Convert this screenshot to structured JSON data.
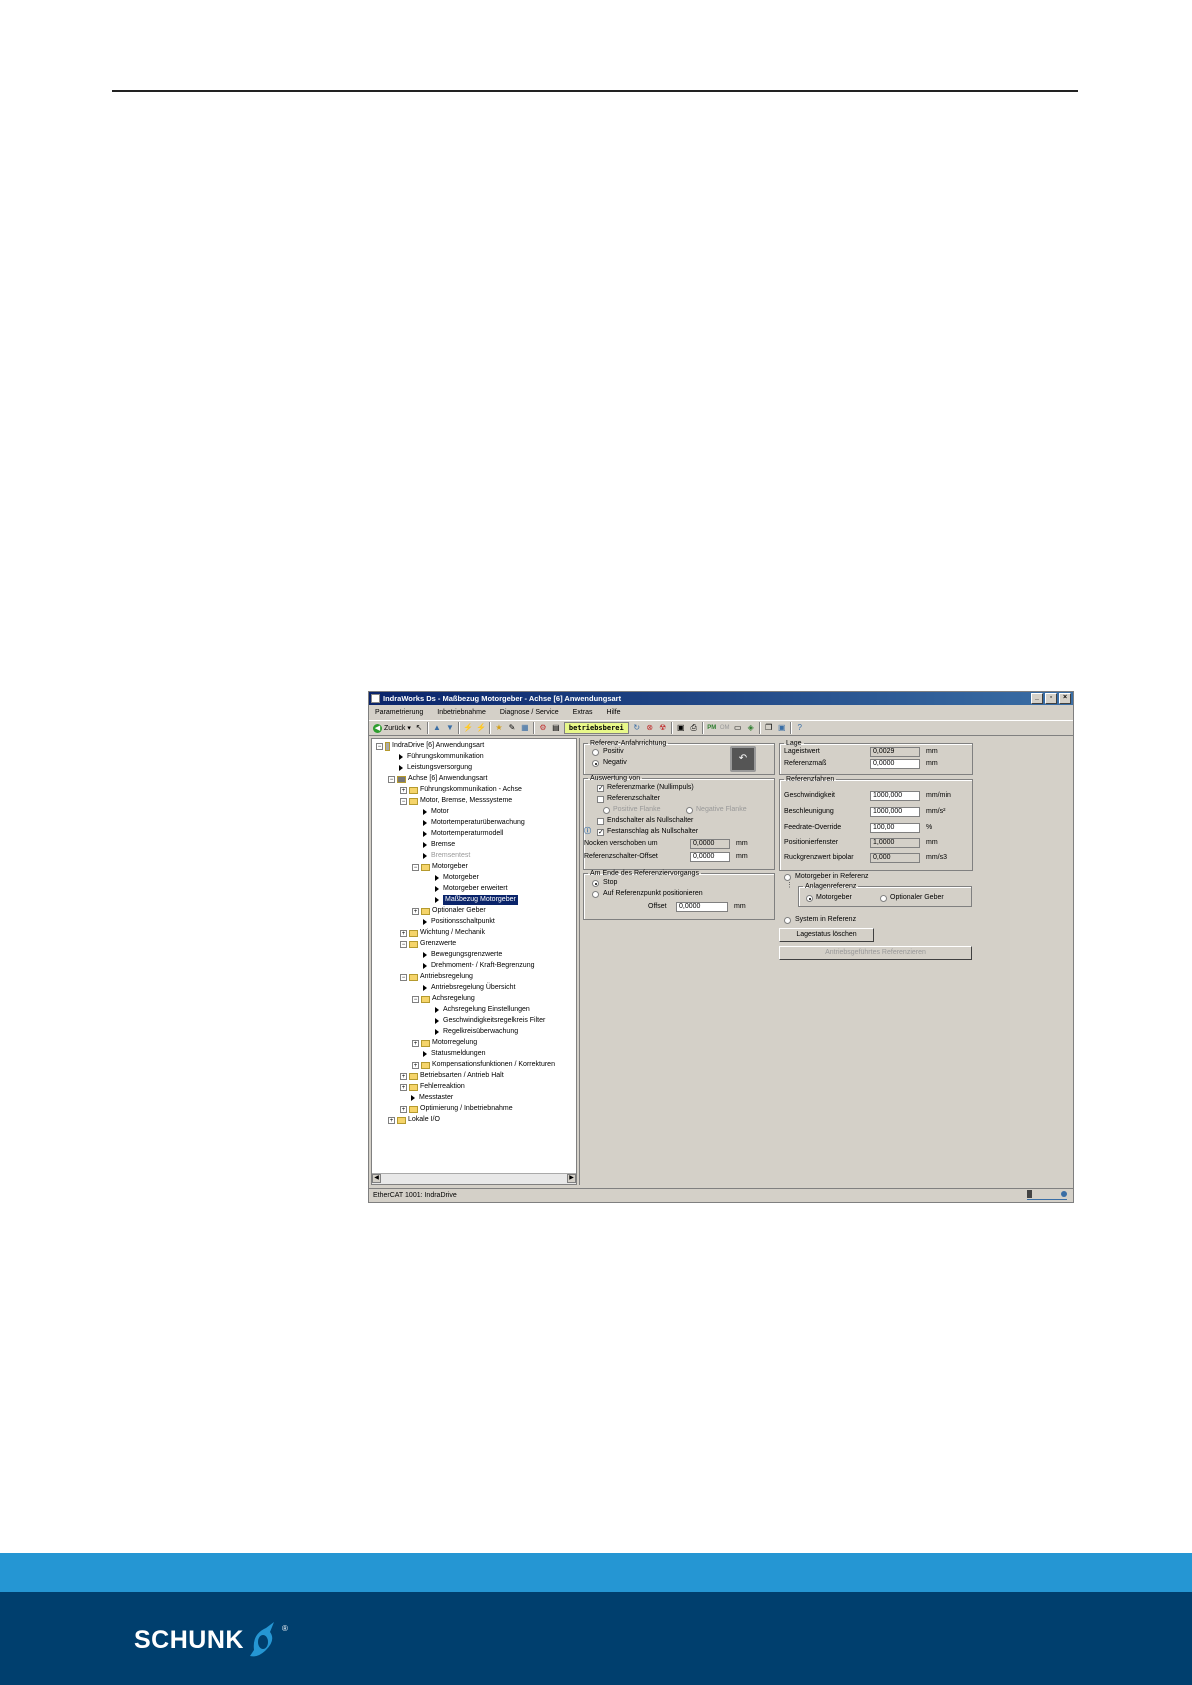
{
  "window": {
    "title": "IndraWorks Ds - Maßbezug Motorgeber - Achse [6] Anwendungsart",
    "controls": [
      "_",
      "▫",
      "×"
    ]
  },
  "menu": [
    "Parametrierung",
    "Inbetriebnahme",
    "Diagnose / Service",
    "Extras",
    "Hilfe"
  ],
  "toolbar": {
    "back_label": "Zurück",
    "status_text": "betriebsberei",
    "pm_label": "PM",
    "om_label": "OM"
  },
  "tree": [
    {
      "text": "IndraDrive [6] Anwendungsart",
      "level": 0,
      "kind": "device",
      "pm": "−"
    },
    {
      "text": "Führungskommunikation",
      "level": 1,
      "kind": "arrow"
    },
    {
      "text": "Leistungsversorgung",
      "level": 1,
      "kind": "arrow"
    },
    {
      "text": "Achse [6] Anwendungsart",
      "level": 1,
      "kind": "axis",
      "pm": "−"
    },
    {
      "text": "Führungskommunikation - Achse",
      "level": 2,
      "kind": "folder",
      "pm": "+"
    },
    {
      "text": "Motor, Bremse, Messsysteme",
      "level": 2,
      "kind": "folder",
      "pm": "−"
    },
    {
      "text": "Motor",
      "level": 3,
      "kind": "arrow"
    },
    {
      "text": "Motortemperaturüberwachung",
      "level": 3,
      "kind": "arrow"
    },
    {
      "text": "Motortemperaturmodell",
      "level": 3,
      "kind": "arrow"
    },
    {
      "text": "Bremse",
      "level": 3,
      "kind": "arrow"
    },
    {
      "text": "Bremsentest",
      "level": 3,
      "kind": "arrow",
      "gray": true
    },
    {
      "text": "Motorgeber",
      "level": 3,
      "kind": "folder",
      "pm": "−"
    },
    {
      "text": "Motorgeber",
      "level": 4,
      "kind": "arrow"
    },
    {
      "text": "Motorgeber erweitert",
      "level": 4,
      "kind": "arrow"
    },
    {
      "text": "Maßbezug Motorgeber",
      "level": 4,
      "kind": "arrow",
      "selected": true
    },
    {
      "text": "Optionaler Geber",
      "level": 3,
      "kind": "folder",
      "pm": "+"
    },
    {
      "text": "Positionsschaltpunkt",
      "level": 3,
      "kind": "arrow"
    },
    {
      "text": "Wichtung / Mechanik",
      "level": 2,
      "kind": "folder",
      "pm": "+"
    },
    {
      "text": "Grenzwerte",
      "level": 2,
      "kind": "folder",
      "pm": "−"
    },
    {
      "text": "Bewegungsgrenzwerte",
      "level": 3,
      "kind": "arrow"
    },
    {
      "text": "Drehmoment- / Kraft-Begrenzung",
      "level": 3,
      "kind": "arrow"
    },
    {
      "text": "Antriebsregelung",
      "level": 2,
      "kind": "folder",
      "pm": "−"
    },
    {
      "text": "Antriebsregelung Übersicht",
      "level": 3,
      "kind": "arrow"
    },
    {
      "text": "Achsregelung",
      "level": 3,
      "kind": "folder",
      "pm": "−"
    },
    {
      "text": "Achsregelung Einstellungen",
      "level": 4,
      "kind": "arrow"
    },
    {
      "text": "Geschwindigkeitsregelkreis Filter",
      "level": 4,
      "kind": "arrow"
    },
    {
      "text": "Regelkreisüberwachung",
      "level": 4,
      "kind": "arrow"
    },
    {
      "text": "Motorregelung",
      "level": 3,
      "kind": "folder",
      "pm": "+"
    },
    {
      "text": "Statusmeldungen",
      "level": 3,
      "kind": "arrow"
    },
    {
      "text": "Kompensationsfunktionen / Korrekturen",
      "level": 3,
      "kind": "folder",
      "pm": "+"
    },
    {
      "text": "Betriebsarten / Antrieb Halt",
      "level": 2,
      "kind": "folder",
      "pm": "+"
    },
    {
      "text": "Fehlerreaktion",
      "level": 2,
      "kind": "folder",
      "pm": "+"
    },
    {
      "text": "Messtaster",
      "level": 2,
      "kind": "arrow"
    },
    {
      "text": "Optimierung / Inbetriebnahme",
      "level": 2,
      "kind": "folder",
      "pm": "+"
    },
    {
      "text": "Lokale I/O",
      "level": 1,
      "kind": "folder",
      "pm": "+"
    }
  ],
  "ref_direction": {
    "legend": "Referenz-Anfahrrichtung",
    "positive": "Positiv",
    "negative": "Negativ",
    "icon": "reference-direction-icon"
  },
  "evaluation": {
    "legend": "Auswertung von",
    "ref_mark": "Referenzmarke (Nullimpuls)",
    "ref_switch": "Referenzschalter",
    "pos_edge": "Positive Flanke",
    "neg_edge": "Negative Flanke",
    "end_switch": "Endschalter als Nullschalter",
    "fixed_stop": "Festanschlag als Nullschalter",
    "cam_shift_label": "Nocken verschoben um",
    "cam_shift_value": "0,0000",
    "cam_shift_unit": "mm",
    "switch_offset_label": "Referenzschalter-Offset",
    "switch_offset_value": "0,0000",
    "switch_offset_unit": "mm"
  },
  "end_of_ref": {
    "legend": "Am Ende des Referenziervorgangs",
    "stop": "Stop",
    "go_to_point": "Auf Referenzpunkt positionieren",
    "offset_label": "Offset",
    "offset_value": "0,0000",
    "offset_unit": "mm"
  },
  "position": {
    "legend": "Lage",
    "actual_label": "Lageistwert",
    "actual_value": "0,0029",
    "actual_unit": "mm",
    "ref_dim_label": "Referenzmaß",
    "ref_dim_value": "0,0000",
    "ref_dim_unit": "mm"
  },
  "ref_travel": {
    "legend": "Referenzfahren",
    "speed_label": "Geschwindigkeit",
    "speed_value": "1000,000",
    "speed_unit": "mm/min",
    "accel_label": "Beschleunigung",
    "accel_value": "1000,000",
    "accel_unit": "mm/s²",
    "override_label": "Feedrate-Override",
    "override_value": "100,00",
    "override_unit": "%",
    "window_label": "Positionierfenster",
    "window_value": "1,0000",
    "window_unit": "mm",
    "jerk_label": "Ruckgrenzwert bipolar",
    "jerk_value": "0,000",
    "jerk_unit": "mm/s3"
  },
  "status_ref": {
    "motor_in_ref": "Motorgeber in Referenz",
    "system_ref_legend": "Anlagenreferenz",
    "motor_enc": "Motorgeber",
    "opt_enc": "Optionaler Geber",
    "system_in_ref": "System in Referenz",
    "clear_button": "Lagestatus löschen",
    "execute_button": "Antriebsgeführtes Referenzieren"
  },
  "statusbar": {
    "text": "EtherCAT 1001: IndraDrive"
  },
  "footer": {
    "brand": "SCHUNK",
    "registered": "®"
  },
  "colors": {
    "footer_light": "#2596d3",
    "footer_dark": "#003f6e",
    "titlebar": "#0a246a"
  }
}
